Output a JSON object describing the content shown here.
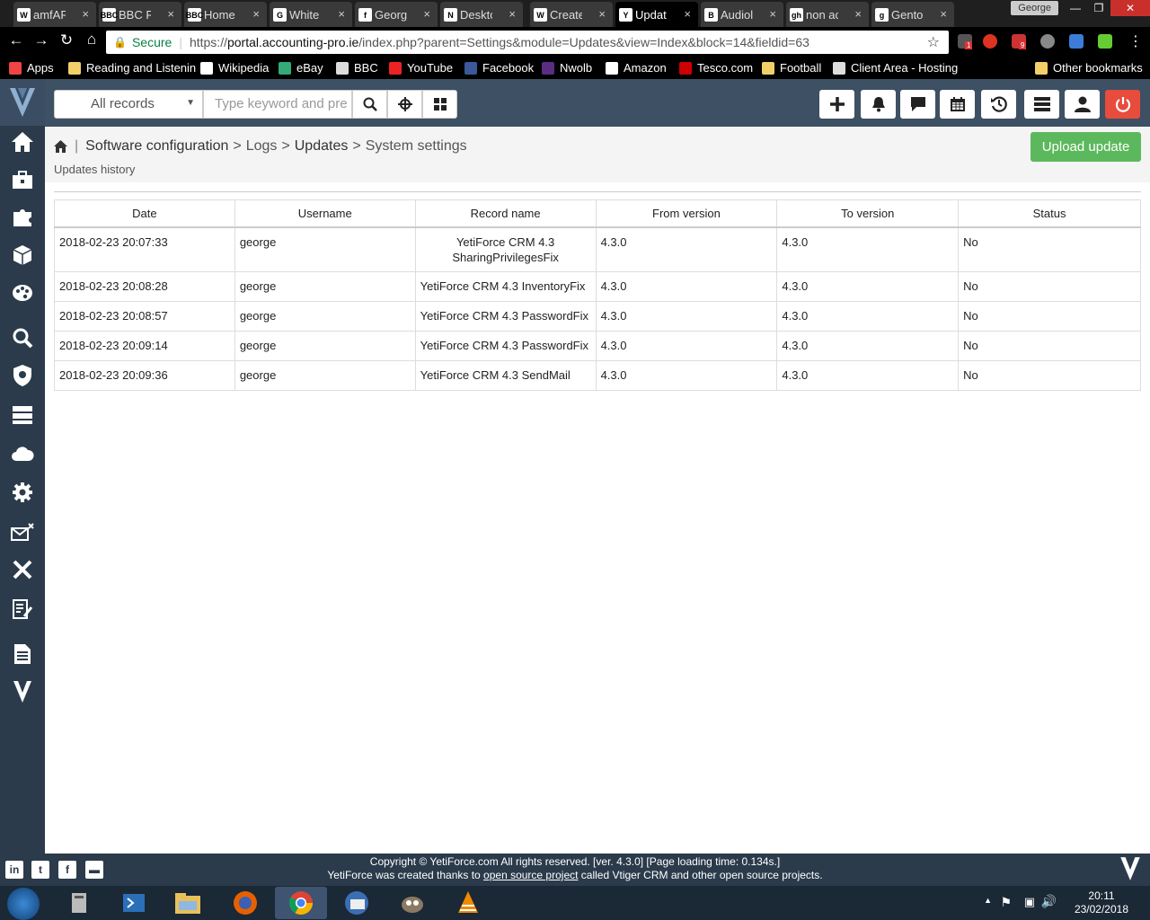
{
  "browser": {
    "tabs": [
      {
        "label": "amfAR",
        "fav": "W"
      },
      {
        "label": "BBC Ra",
        "fav": "BBC"
      },
      {
        "label": "Home",
        "fav": "BBC"
      },
      {
        "label": "White",
        "fav": "G"
      },
      {
        "label": "Georg",
        "fav": "f"
      },
      {
        "label": "Deskto",
        "fav": "N"
      },
      {
        "label": "Create",
        "fav": "W"
      },
      {
        "label": "Updat",
        "fav": "Y"
      },
      {
        "label": "Audiol",
        "fav": "B"
      },
      {
        "label": "non ac",
        "fav": "gh"
      },
      {
        "label": "Gento",
        "fav": "g"
      }
    ],
    "close_glyph": "×",
    "profile_user": "George",
    "address": {
      "secure_label": "Secure",
      "scheme": "https://",
      "host": "portal.accounting-pro.ie",
      "path": "/index.php?parent=Settings&module=Updates&view=Index&block=14&fieldid=63"
    },
    "extension_badges": {
      "mail": "9",
      "alert": "1"
    },
    "bookmarks": [
      {
        "label": "Apps",
        "icon": "apps-grid-icon"
      },
      {
        "label": "Reading and Listenin",
        "icon": "folder-icon"
      },
      {
        "label": "Wikipedia",
        "icon": "wikipedia-icon"
      },
      {
        "label": "eBay",
        "icon": "ebay-icon"
      },
      {
        "label": "BBC",
        "icon": "bbc-icon"
      },
      {
        "label": "YouTube",
        "icon": "youtube-icon"
      },
      {
        "label": "Facebook",
        "icon": "facebook-icon"
      },
      {
        "label": "Nwolb",
        "icon": "natwest-icon"
      },
      {
        "label": "Amazon",
        "icon": "amazon-icon"
      },
      {
        "label": "Tesco.com",
        "icon": "tesco-icon"
      },
      {
        "label": "Football",
        "icon": "folder-icon"
      },
      {
        "label": "Client Area - Hosting",
        "icon": "page-icon"
      },
      {
        "label": "Other bookmarks",
        "icon": "folder-icon"
      }
    ]
  },
  "topnav": {
    "record_select": "All records",
    "keyword_placeholder": "Type keyword and pre"
  },
  "page": {
    "breadcrumb": [
      "Software configuration",
      "Logs",
      "Updates",
      "System settings"
    ],
    "breadcrumb_sep": ">",
    "subtitle": "Updates history",
    "upload_button": "Upload update"
  },
  "table": {
    "columns": [
      "Date",
      "Username",
      "Record name",
      "From version",
      "To version",
      "Status"
    ],
    "rows": [
      {
        "date": "2018-02-23 20:07:33",
        "user": "george",
        "record": "YetiForce CRM 4.3 SharingPrivilegesFix",
        "from": "4.3.0",
        "to": "4.3.0",
        "status": "No"
      },
      {
        "date": "2018-02-23 20:08:28",
        "user": "george",
        "record": "YetiForce CRM 4.3 InventoryFix",
        "from": "4.3.0",
        "to": "4.3.0",
        "status": "No"
      },
      {
        "date": "2018-02-23 20:08:57",
        "user": "george",
        "record": "YetiForce CRM 4.3 PasswordFix",
        "from": "4.3.0",
        "to": "4.3.0",
        "status": "No"
      },
      {
        "date": "2018-02-23 20:09:14",
        "user": "george",
        "record": "YetiForce CRM 4.3 PasswordFix",
        "from": "4.3.0",
        "to": "4.3.0",
        "status": "No"
      },
      {
        "date": "2018-02-23 20:09:36",
        "user": "george",
        "record": "YetiForce CRM 4.3 SendMail",
        "from": "4.3.0",
        "to": "4.3.0",
        "status": "No"
      }
    ]
  },
  "footer": {
    "line1": "Copyright © YetiForce.com All rights reserved. [ver. 4.3.0] [Page loading time: 0.134s.]",
    "line2_pre": "YetiForce was created thanks to ",
    "line2_link": "open source project",
    "line2_post": " called Vtiger CRM and other open source projects."
  },
  "taskbar": {
    "time": "20:11",
    "date": "23/02/2018"
  },
  "colors": {
    "sidebar": "#2b3b4b",
    "topnav": "#3e5063",
    "upload": "#5cb85c",
    "power": "#e74c3c"
  }
}
